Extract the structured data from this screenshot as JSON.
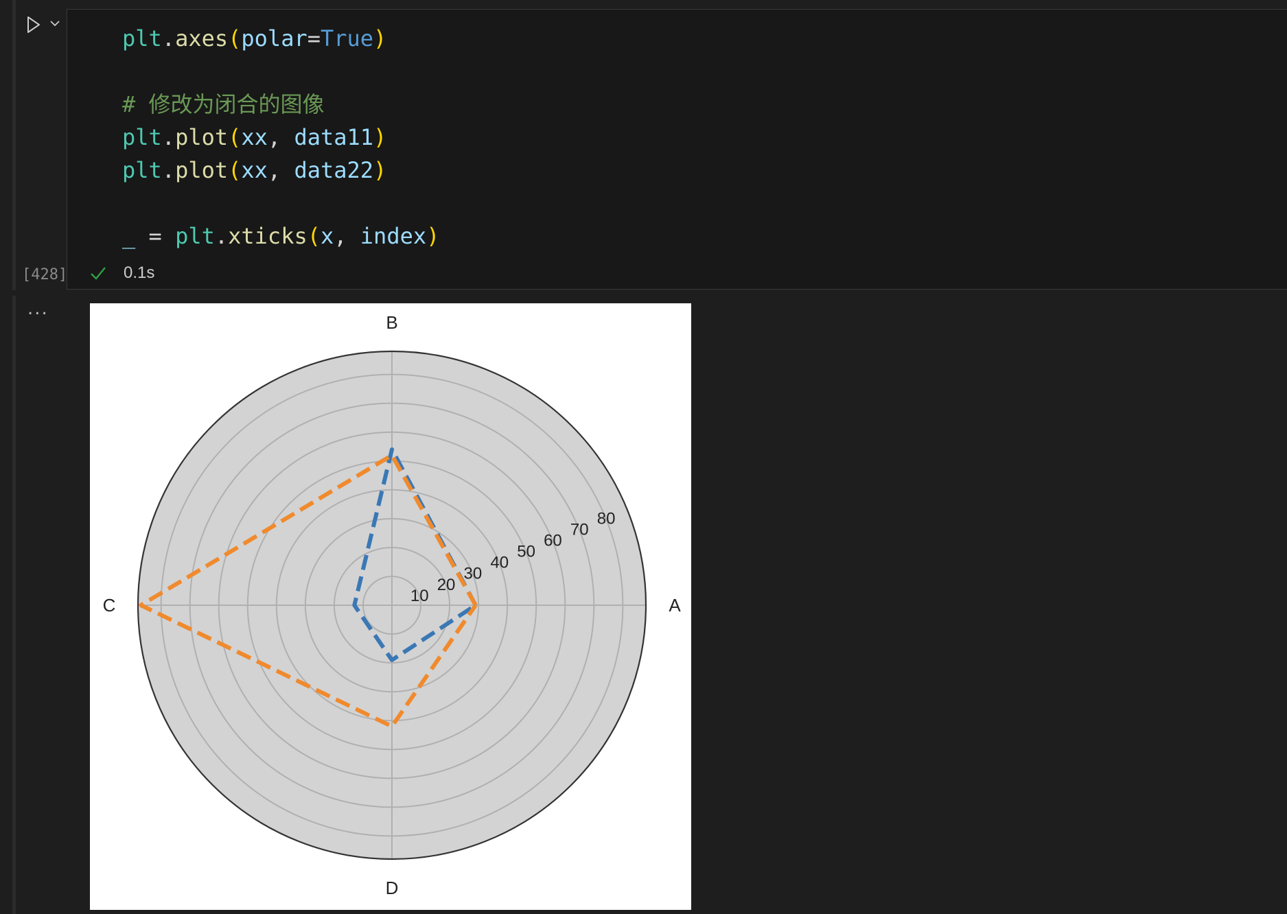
{
  "cell": {
    "execution_count": "[428]",
    "status_time": "0.1s",
    "code_lines": [
      [
        [
          "plt",
          "t-mod"
        ],
        [
          ".",
          "t-op"
        ],
        [
          "axes",
          "t-fn"
        ],
        [
          "(",
          "t-par"
        ],
        [
          "polar",
          "t-var"
        ],
        [
          "=",
          "t-op"
        ],
        [
          "True",
          "t-kw"
        ],
        [
          ")",
          "t-par"
        ]
      ],
      [],
      [
        [
          "# 修改为闭合的图像",
          "t-com"
        ]
      ],
      [
        [
          "plt",
          "t-mod"
        ],
        [
          ".",
          "t-op"
        ],
        [
          "plot",
          "t-fn"
        ],
        [
          "(",
          "t-par"
        ],
        [
          "xx",
          "t-var"
        ],
        [
          ", ",
          "t-op"
        ],
        [
          "data11",
          "t-var"
        ],
        [
          ")",
          "t-par"
        ]
      ],
      [
        [
          "plt",
          "t-mod"
        ],
        [
          ".",
          "t-op"
        ],
        [
          "plot",
          "t-fn"
        ],
        [
          "(",
          "t-par"
        ],
        [
          "xx",
          "t-var"
        ],
        [
          ", ",
          "t-op"
        ],
        [
          "data22",
          "t-var"
        ],
        [
          ")",
          "t-par"
        ]
      ],
      [],
      [
        [
          "_",
          "t-var"
        ],
        [
          " = ",
          "t-op"
        ],
        [
          "plt",
          "t-mod"
        ],
        [
          ".",
          "t-op"
        ],
        [
          "xticks",
          "t-fn"
        ],
        [
          "(",
          "t-par"
        ],
        [
          "x",
          "t-var"
        ],
        [
          ", ",
          "t-op"
        ],
        [
          "index",
          "t-var"
        ],
        [
          ")",
          "t-par"
        ]
      ]
    ]
  },
  "output": {
    "more_label": "..."
  },
  "chart_data": {
    "type": "polar-line",
    "categories": [
      "A",
      "B",
      "C",
      "D"
    ],
    "angles_deg": [
      0,
      90,
      180,
      270
    ],
    "radial_ticks": [
      10,
      20,
      30,
      40,
      50,
      60,
      70,
      80
    ],
    "rlim": [
      0,
      88
    ],
    "grid": true,
    "background": "#d3d3d3",
    "series": [
      {
        "values": [
          29,
          54,
          13,
          19
        ],
        "color": "#3a78b5",
        "linestyle": "dashed"
      },
      {
        "values": [
          29,
          52,
          87,
          42
        ],
        "color": "#f08a2d",
        "linestyle": "dashed"
      }
    ]
  }
}
